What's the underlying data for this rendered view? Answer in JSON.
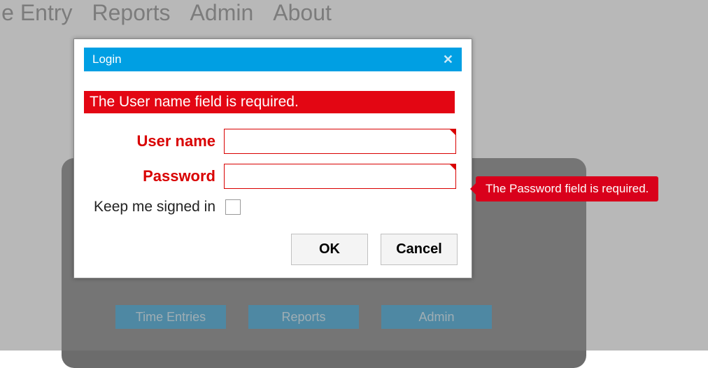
{
  "nav": {
    "items": [
      "Time Entry",
      "Reports",
      "Admin",
      "About"
    ]
  },
  "tiles": {
    "items": [
      "Time Entries",
      "Reports",
      "Admin"
    ]
  },
  "dialog": {
    "title": "Login",
    "error_summary": "The User name field is required.",
    "username_label": "User name",
    "password_label": "Password",
    "keep_signed_label": "Keep me signed in",
    "ok_label": "OK",
    "cancel_label": "Cancel"
  },
  "tooltip": {
    "password_error": "The Password field is required."
  }
}
